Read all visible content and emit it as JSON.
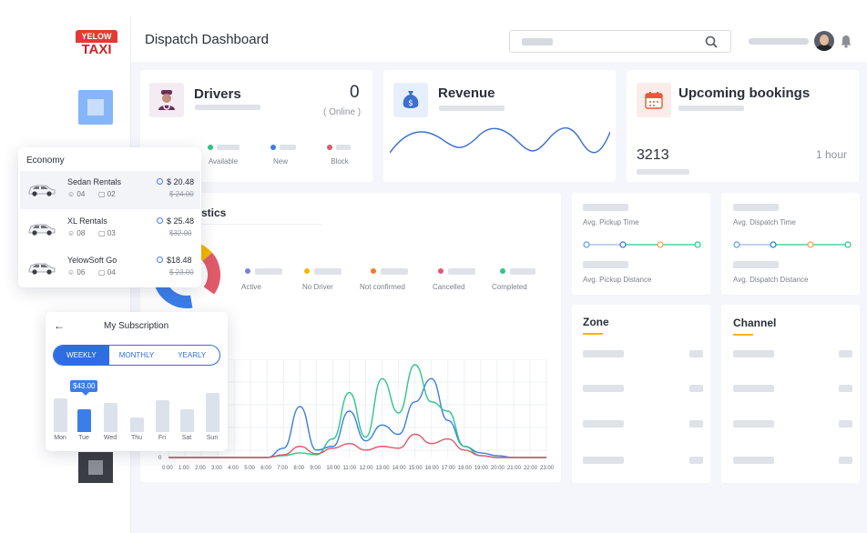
{
  "brand": {
    "logo_top": "YELOW",
    "logo_bottom": "TAXI"
  },
  "header": {
    "title": "Dispatch Dashboard"
  },
  "colors": {
    "accent": "#2f6de3",
    "brand_red": "#e53935",
    "yellow": "#f2b800",
    "green": "#2ec58a",
    "red": "#e05a6a"
  },
  "drivers": {
    "title": "Drivers",
    "count": "0",
    "sub": "( Online )",
    "legend": [
      {
        "label": "Available",
        "color": "#2ec58a"
      },
      {
        "label": "New",
        "color": "#3b7ee8"
      },
      {
        "label": "Block",
        "color": "#e05a6a"
      }
    ]
  },
  "revenue": {
    "title": "Revenue"
  },
  "upcoming": {
    "title": "Upcoming bookings",
    "count": "3213",
    "time": "1 hour"
  },
  "statistics": {
    "title_fragment": "stics",
    "legend": [
      {
        "label": "Active",
        "color": "#7b7fe0"
      },
      {
        "label": "No Driver",
        "color": "#f2b800"
      },
      {
        "label": "Not confirmed",
        "color": "#f27a2c"
      },
      {
        "label": "Cancelled",
        "color": "#e05a6a"
      },
      {
        "label": "Completed",
        "color": "#2ec58a"
      }
    ]
  },
  "metrics": {
    "pickup_time": "Avg. Pickup Time",
    "pickup_distance": "Avg. Pickup Distance",
    "dispatch_time": "Avg. Dispatch Time",
    "dispatch_distance": "Avg. Dispatch Distance"
  },
  "zone": {
    "title": "Zone"
  },
  "channel": {
    "title": "Channel"
  },
  "economy": {
    "title": "Economy",
    "items": [
      {
        "name": "Sedan Rentals",
        "seats": "04",
        "bags": "02",
        "price": "$ 20.48",
        "old_price": "$ 24.00"
      },
      {
        "name": "XL Rentals",
        "seats": "08",
        "bags": "03",
        "price": "$ 25.48",
        "old_price": "$32.00"
      },
      {
        "name": "YelowSoft Go",
        "seats": "06",
        "bags": "04",
        "price": "$18.48",
        "old_price": "$ 23.00"
      }
    ]
  },
  "subscription": {
    "title": "My Subscription",
    "tabs": [
      "WEEKLY",
      "MONTHLY",
      "YEARLY"
    ],
    "selected_tab": "WEEKLY",
    "tooltip": "$43.00",
    "days": [
      "Mon",
      "Tue",
      "Wed",
      "Thu",
      "Fri",
      "Sat",
      "Sun"
    ],
    "bar_levels": [
      0.62,
      0.42,
      0.54,
      0.26,
      0.58,
      0.42,
      0.72
    ],
    "selected_day": "Tue"
  },
  "chart_data": {
    "type": "line",
    "x": [
      "0:00",
      "1:00",
      "2:00",
      "3:00",
      "4:00",
      "5:00",
      "6:00",
      "7:00",
      "8:00",
      "9:00",
      "10:00",
      "11:00",
      "12:00",
      "13:00",
      "14:00",
      "15:00",
      "16:00",
      "17:00",
      "18:00",
      "19:00",
      "20:00",
      "21:00",
      "22:00",
      "23:00"
    ],
    "y_tick_shown": "0",
    "series": [
      {
        "color": "#3b7ee8",
        "values": [
          0,
          0,
          0,
          0,
          0,
          0,
          0,
          10,
          55,
          8,
          12,
          50,
          18,
          35,
          25,
          60,
          85,
          40,
          12,
          5,
          2,
          0,
          0,
          0
        ]
      },
      {
        "color": "#2ec58a",
        "values": [
          0,
          0,
          0,
          0,
          0,
          0,
          0,
          2,
          5,
          3,
          20,
          70,
          22,
          85,
          48,
          100,
          60,
          50,
          12,
          2,
          0,
          0,
          0,
          0
        ]
      },
      {
        "color": "#e05a6a",
        "values": [
          0,
          0,
          0,
          0,
          0,
          0,
          0,
          3,
          12,
          4,
          10,
          15,
          8,
          12,
          10,
          25,
          15,
          20,
          8,
          2,
          0,
          0,
          0,
          0
        ]
      }
    ]
  }
}
